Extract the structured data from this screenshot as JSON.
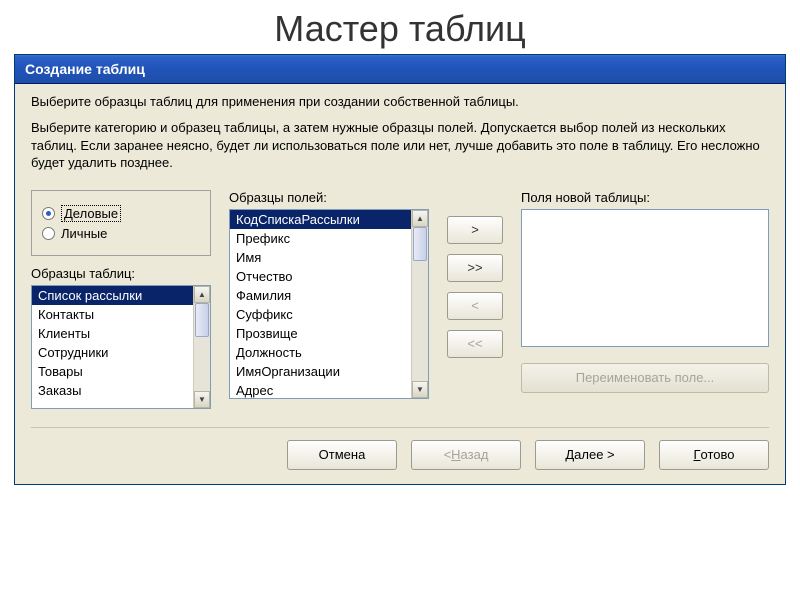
{
  "slide_title": "Мастер таблиц",
  "window": {
    "title": "Создание таблиц",
    "intro1": "Выберите образцы таблиц для применения при создании собственной таблицы.",
    "intro2": "Выберите категорию и образец таблицы, а затем нужные образцы полей. Допускается выбор полей из нескольких таблиц. Если заранее неясно, будет ли использоваться поле или нет, лучше добавить это поле в таблицу. Его несложно будет удалить позднее."
  },
  "category": {
    "business": "Деловые",
    "personal": "Личные"
  },
  "sample_tables_label": "Образцы таблиц:",
  "sample_tables": [
    "Список рассылки",
    "Контакты",
    "Клиенты",
    "Сотрудники",
    "Товары",
    "Заказы"
  ],
  "sample_fields_label": "Образцы полей:",
  "sample_fields": [
    "КодСпискаРассылки",
    "Префикс",
    "Имя",
    "Отчество",
    "Фамилия",
    "Суффикс",
    "Прозвище",
    "Должность",
    "ИмяОрганизации",
    "Адрес"
  ],
  "new_fields_label": "Поля новой таблицы:",
  "transfer": {
    "add": ">",
    "add_all": ">>",
    "remove": "<",
    "remove_all": "<<"
  },
  "rename_label": "Переименовать поле...",
  "footer": {
    "cancel": "Отмена",
    "back_prefix": "< ",
    "back_letter": "Н",
    "back_rest": "азад",
    "next_letter": "Д",
    "next_rest": "алее >",
    "finish_letter": "Г",
    "finish_rest": "отово"
  }
}
